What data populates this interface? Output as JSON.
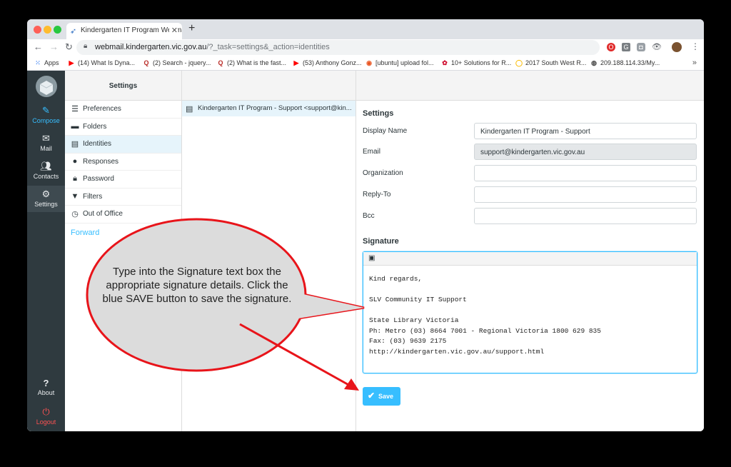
{
  "browser": {
    "tab_title": "Kindergarten IT Program Webmail",
    "url_host": "webmail.kindergarten.vic.gov.au",
    "url_path": "/?_task=settings&_action=identities",
    "bookmarks": [
      {
        "icon": "apps-icon",
        "label": "Apps"
      },
      {
        "icon": "youtube-icon",
        "label": "(14) What Is Dyna..."
      },
      {
        "icon": "quora-icon",
        "label": "(2) Search - jquery..."
      },
      {
        "icon": "quora-icon",
        "label": "(2) What is the fast..."
      },
      {
        "icon": "youtube-icon",
        "label": "(53) Anthony Gonz..."
      },
      {
        "icon": "ubuntu-icon",
        "label": "[ubuntu] upload fol..."
      },
      {
        "icon": "huawei-icon",
        "label": "10+ Solutions for R..."
      },
      {
        "icon": "google-icon",
        "label": "2017 South West R..."
      },
      {
        "icon": "globe-icon",
        "label": "209.188.114.33/My..."
      }
    ]
  },
  "rail": {
    "compose": "Compose",
    "mail": "Mail",
    "contacts": "Contacts",
    "settings": "Settings",
    "about": "About",
    "logout": "Logout"
  },
  "settings_panel": {
    "title": "Settings",
    "items": [
      {
        "label": "Preferences",
        "icon": "sliders-icon"
      },
      {
        "label": "Folders",
        "icon": "folder-icon"
      },
      {
        "label": "Identities",
        "icon": "id-card-icon"
      },
      {
        "label": "Responses",
        "icon": "comment-icon"
      },
      {
        "label": "Password",
        "icon": "lock-icon"
      },
      {
        "label": "Filters",
        "icon": "filter-icon"
      },
      {
        "label": "Out of Office",
        "icon": "clock-icon"
      }
    ],
    "forward": "Forward"
  },
  "identities": {
    "row": "Kindergarten IT Program - Support <support@kin..."
  },
  "form": {
    "heading": "Settings",
    "display_name_label": "Display Name",
    "display_name_value": "Kindergarten IT Program - Support",
    "email_label": "Email",
    "email_value": "support@kindergarten.vic.gov.au",
    "organization_label": "Organization",
    "organization_value": "",
    "reply_to_label": "Reply-To",
    "reply_to_value": "",
    "bcc_label": "Bcc",
    "bcc_value": "",
    "signature_heading": "Signature",
    "signature_text": "Kind regards,\n\nSLV Community IT Support\n\nState Library Victoria\nPh: Metro (03) 8664 7001 - Regional Victoria 1800 629 835\nFax: (03) 9639 2175\nhttp://kindergarten.vic.gov.au/support.html",
    "save_label": "Save"
  },
  "annotation": {
    "text": "Type into the Signature text box the appropriate signature details. Click the blue SAVE button to save the signature.",
    "color": "#e8141a"
  }
}
